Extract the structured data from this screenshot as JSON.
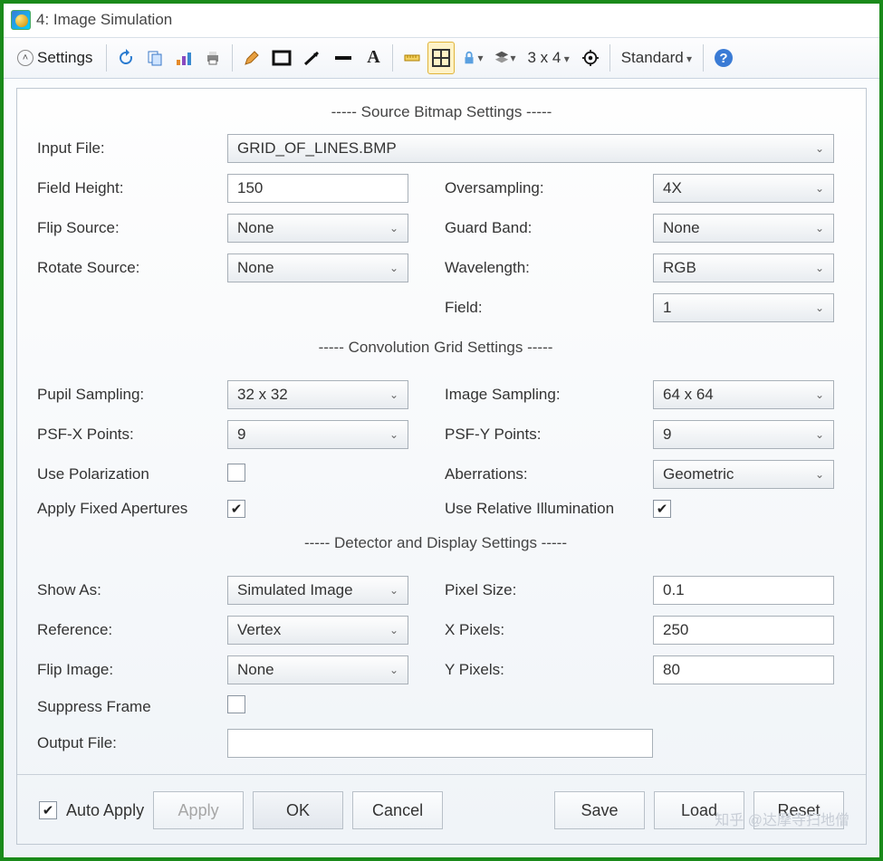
{
  "window": {
    "title": "4: Image Simulation"
  },
  "toolbar": {
    "settings_label": "Settings",
    "grid_label": "3 x 4",
    "standard_label": "Standard"
  },
  "sections": {
    "source": "-----  Source Bitmap Settings  -----",
    "conv": "-----  Convolution Grid Settings  -----",
    "detector": "-----  Detector and Display Settings  -----"
  },
  "labels": {
    "input_file": "Input File:",
    "field_height": "Field Height:",
    "oversampling": "Oversampling:",
    "flip_source": "Flip Source:",
    "guard_band": "Guard Band:",
    "rotate_source": "Rotate Source:",
    "wavelength": "Wavelength:",
    "field": "Field:",
    "pupil_sampling": "Pupil Sampling:",
    "image_sampling": "Image Sampling:",
    "psfx": "PSF-X Points:",
    "psfy": "PSF-Y Points:",
    "use_polarization": "Use Polarization",
    "aberrations": "Aberrations:",
    "apply_fixed_apertures": "Apply Fixed Apertures",
    "use_relative_illum": "Use Relative Illumination",
    "show_as": "Show As:",
    "pixel_size": "Pixel Size:",
    "reference": "Reference:",
    "x_pixels": "X Pixels:",
    "flip_image": "Flip Image:",
    "y_pixels": "Y Pixels:",
    "suppress_frame": "Suppress Frame",
    "output_file": "Output File:"
  },
  "values": {
    "input_file": "GRID_OF_LINES.BMP",
    "field_height": "150",
    "oversampling": "4X",
    "flip_source": "None",
    "guard_band": "None",
    "rotate_source": "None",
    "wavelength": "RGB",
    "field": "1",
    "pupil_sampling": "32 x 32",
    "image_sampling": "64 x 64",
    "psfx": "9",
    "psfy": "9",
    "use_polarization": false,
    "aberrations": "Geometric",
    "apply_fixed_apertures": true,
    "use_relative_illum": true,
    "show_as": "Simulated Image",
    "pixel_size": "0.1",
    "reference": "Vertex",
    "x_pixels": "250",
    "flip_image": "None",
    "y_pixels": "80",
    "suppress_frame": false,
    "output_file": ""
  },
  "buttons": {
    "auto_apply": "Auto Apply",
    "apply": "Apply",
    "ok": "OK",
    "cancel": "Cancel",
    "save": "Save",
    "load": "Load",
    "reset": "Reset"
  },
  "checks": {
    "auto_apply": true
  },
  "watermark": "知乎 @达摩寺扫地僧"
}
